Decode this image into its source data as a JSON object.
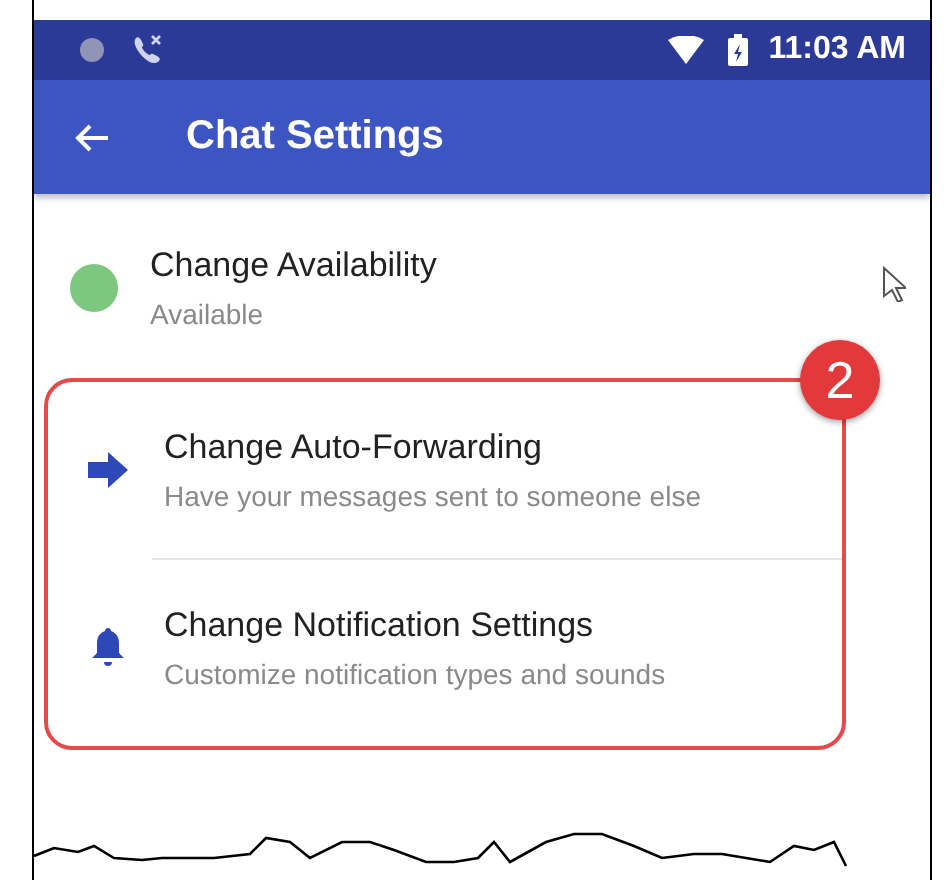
{
  "status_bar": {
    "time": "11:03 AM"
  },
  "app_bar": {
    "title": "Chat Settings"
  },
  "items": [
    {
      "kind": "dot",
      "color": "#7dc87f",
      "title": "Change Availability",
      "subtitle": "Available"
    }
  ],
  "callout": {
    "badge": "2",
    "items": [
      {
        "kind": "arrow",
        "title": "Change Auto-Forwarding",
        "subtitle": "Have your messages sent to someone else"
      },
      {
        "kind": "bell",
        "title": "Change Notification Settings",
        "subtitle": "Customize notification types and sounds"
      }
    ]
  }
}
